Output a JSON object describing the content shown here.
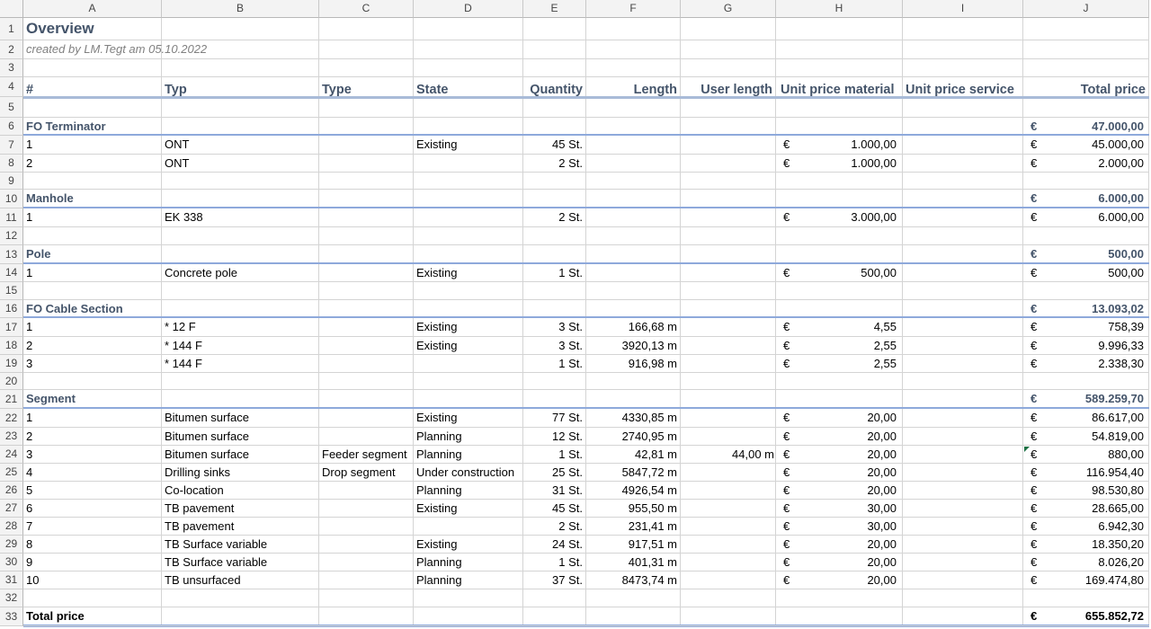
{
  "columns": [
    "A",
    "B",
    "C",
    "D",
    "E",
    "F",
    "G",
    "H",
    "I",
    "J"
  ],
  "row_numbers": [
    "1",
    "2",
    "3",
    "4",
    "5",
    "6",
    "7",
    "8",
    "9",
    "10",
    "11",
    "12",
    "13",
    "14",
    "15",
    "16",
    "17",
    "18",
    "19",
    "20",
    "21",
    "22",
    "23",
    "24",
    "25",
    "26",
    "27",
    "28",
    "29",
    "30",
    "31",
    "32",
    "33"
  ],
  "title": "Overview",
  "subtitle": "created by LM.Tegt am 05.10.2022",
  "headers": {
    "num": "#",
    "typ": "Typ",
    "type": "Type",
    "state": "State",
    "quantity": "Quantity",
    "length": "Length",
    "user_length": "User length",
    "unit_material": "Unit price material",
    "unit_service": "Unit price service",
    "total": "Total price"
  },
  "currency": "€",
  "sections": [
    {
      "row": 6,
      "name": "FO Terminator",
      "total": "47.000,00",
      "items": [
        {
          "row": 7,
          "num": "1",
          "typ": "ONT",
          "type": "",
          "state": "Existing",
          "qty": "45 St.",
          "length": "",
          "user_length": "",
          "unit_material": "1.000,00",
          "unit_service": "",
          "total": "45.000,00"
        },
        {
          "row": 8,
          "num": "2",
          "typ": "ONT",
          "type": "",
          "state": "",
          "qty": "2 St.",
          "length": "",
          "user_length": "",
          "unit_material": "1.000,00",
          "unit_service": "",
          "total": "2.000,00"
        }
      ]
    },
    {
      "row": 10,
      "name": "Manhole",
      "total": "6.000,00",
      "items": [
        {
          "row": 11,
          "num": "1",
          "typ": "EK 338",
          "type": "",
          "state": "",
          "qty": "2 St.",
          "length": "",
          "user_length": "",
          "unit_material": "3.000,00",
          "unit_service": "",
          "total": "6.000,00"
        }
      ]
    },
    {
      "row": 13,
      "name": "Pole",
      "total": "500,00",
      "items": [
        {
          "row": 14,
          "num": "1",
          "typ": "Concrete pole",
          "type": "",
          "state": "Existing",
          "qty": "1 St.",
          "length": "",
          "user_length": "",
          "unit_material": "500,00",
          "unit_service": "",
          "total": "500,00"
        }
      ]
    },
    {
      "row": 16,
      "name": "FO Cable Section",
      "total": "13.093,02",
      "items": [
        {
          "row": 17,
          "num": "1",
          "typ": "* 12 F",
          "type": "",
          "state": "Existing",
          "qty": "3 St.",
          "length": "166,68 m",
          "user_length": "",
          "unit_material": "4,55",
          "unit_service": "",
          "total": "758,39"
        },
        {
          "row": 18,
          "num": "2",
          "typ": "* 144 F",
          "type": "",
          "state": "Existing",
          "qty": "3 St.",
          "length": "3920,13 m",
          "user_length": "",
          "unit_material": "2,55",
          "unit_service": "",
          "total": "9.996,33"
        },
        {
          "row": 19,
          "num": "3",
          "typ": "* 144 F",
          "type": "",
          "state": "",
          "qty": "1 St.",
          "length": "916,98 m",
          "user_length": "",
          "unit_material": "2,55",
          "unit_service": "",
          "total": "2.338,30"
        }
      ]
    },
    {
      "row": 21,
      "name": "Segment",
      "total": "589.259,70",
      "items": [
        {
          "row": 22,
          "num": "1",
          "typ": "Bitumen surface",
          "type": "",
          "state": "Existing",
          "qty": "77 St.",
          "length": "4330,85 m",
          "user_length": "",
          "unit_material": "20,00",
          "unit_service": "",
          "total": "86.617,00"
        },
        {
          "row": 23,
          "num": "2",
          "typ": "Bitumen surface",
          "type": "",
          "state": "Planning",
          "qty": "12 St.",
          "length": "2740,95 m",
          "user_length": "",
          "unit_material": "20,00",
          "unit_service": "",
          "total": "54.819,00"
        },
        {
          "row": 24,
          "num": "3",
          "typ": "Bitumen surface",
          "type": "Feeder segment",
          "state": "Planning",
          "qty": "1 St.",
          "length": "42,81 m",
          "user_length": "44,00 m",
          "unit_material": "20,00",
          "unit_service": "",
          "total": "880,00"
        },
        {
          "row": 25,
          "num": "4",
          "typ": "Drilling sinks",
          "type": "Drop segment",
          "state": "Under construction",
          "qty": "25 St.",
          "length": "5847,72 m",
          "user_length": "",
          "unit_material": "20,00",
          "unit_service": "",
          "total": "116.954,40"
        },
        {
          "row": 26,
          "num": "5",
          "typ": "Co-location",
          "type": "",
          "state": "Planning",
          "qty": "31 St.",
          "length": "4926,54 m",
          "user_length": "",
          "unit_material": "20,00",
          "unit_service": "",
          "total": "98.530,80"
        },
        {
          "row": 27,
          "num": "6",
          "typ": "TB pavement",
          "type": "",
          "state": "Existing",
          "qty": "45 St.",
          "length": "955,50 m",
          "user_length": "",
          "unit_material": "30,00",
          "unit_service": "",
          "total": "28.665,00"
        },
        {
          "row": 28,
          "num": "7",
          "typ": "TB pavement",
          "type": "",
          "state": "",
          "qty": "2 St.",
          "length": "231,41 m",
          "user_length": "",
          "unit_material": "30,00",
          "unit_service": "",
          "total": "6.942,30"
        },
        {
          "row": 29,
          "num": "8",
          "typ": "TB Surface variable",
          "type": "",
          "state": "Existing",
          "qty": "24 St.",
          "length": "917,51 m",
          "user_length": "",
          "unit_material": "20,00",
          "unit_service": "",
          "total": "18.350,20"
        },
        {
          "row": 30,
          "num": "9",
          "typ": "TB Surface variable",
          "type": "",
          "state": "Planning",
          "qty": "1 St.",
          "length": "401,31 m",
          "user_length": "",
          "unit_material": "20,00",
          "unit_service": "",
          "total": "8.026,20"
        },
        {
          "row": 31,
          "num": "10",
          "typ": "TB unsurfaced",
          "type": "",
          "state": "Planning",
          "qty": "37 St.",
          "length": "8473,74 m",
          "user_length": "",
          "unit_material": "20,00",
          "unit_service": "",
          "total": "169.474,80"
        }
      ]
    }
  ],
  "grand_total": {
    "row": 33,
    "label": "Total price",
    "value": "655.852,72"
  }
}
